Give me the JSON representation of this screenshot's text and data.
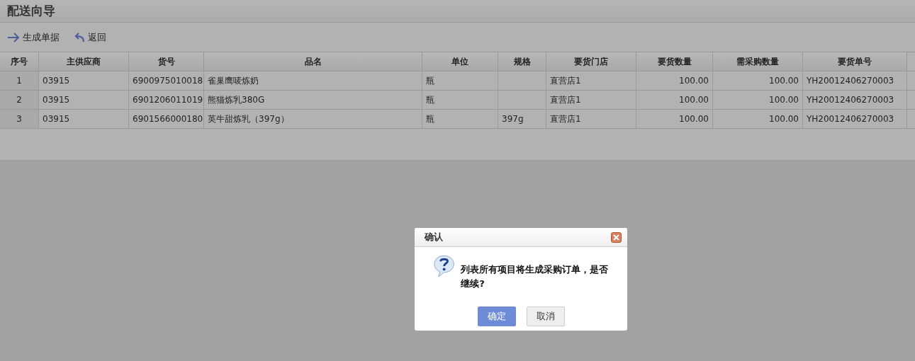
{
  "page": {
    "title": "配送向导"
  },
  "toolbar": [
    {
      "kind": "forward",
      "label": "生成单据"
    },
    {
      "kind": "back",
      "label": "返回"
    }
  ],
  "table": {
    "columns": [
      "序号",
      "主供应商",
      "货号",
      "品名",
      "单位",
      "规格",
      "要货门店",
      "要货数量",
      "需采购数量",
      "要货单号"
    ],
    "rows": [
      [
        "1",
        "03915",
        "6900975010018",
        "雀巢鹰唛炼奶",
        "瓶",
        "",
        "直营店1",
        "100.00",
        "100.00",
        "YH20012406270003"
      ],
      [
        "2",
        "03915",
        "6901206011019",
        "熊猫炼乳380G",
        "瓶",
        "",
        "直营店1",
        "100.00",
        "100.00",
        "YH20012406270003"
      ],
      [
        "3",
        "03915",
        "6901566000180",
        "英牛甜炼乳（397g）",
        "瓶",
        "397g",
        "直营店1",
        "100.00",
        "100.00",
        "YH20012406270003"
      ]
    ]
  },
  "dialog": {
    "title": "确认",
    "message": "列表所有项目将生成采购订单，是否继续?",
    "buttons": [
      {
        "label": "确定",
        "primary": true
      },
      {
        "label": "取消",
        "primary": false
      }
    ]
  }
}
